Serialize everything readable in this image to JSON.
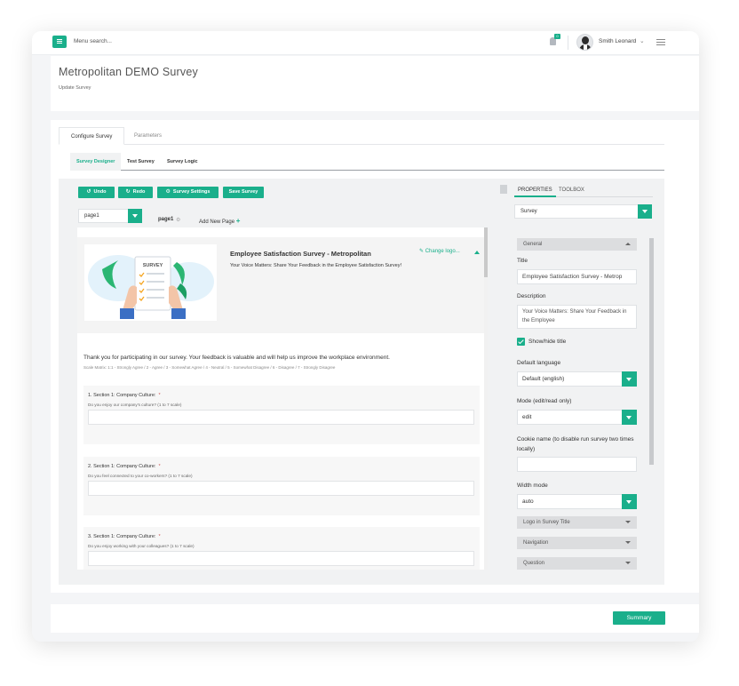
{
  "topbar": {
    "menu_placeholder": "Menu search...",
    "notification_count": "0",
    "user_name": "Smith Leonard",
    "user_caret": "⌄"
  },
  "header": {
    "title": "Metropolitan DEMO Survey",
    "subtitle": "Update Survey"
  },
  "outer_tabs": [
    "Configure Survey",
    "Parameters"
  ],
  "inner_tabs": [
    "Survey Designer",
    "Test Survey",
    "Survey Logic"
  ],
  "toolbar": {
    "undo": "Undo",
    "redo": "Redo",
    "settings": "Survey Settings",
    "save": "Save Survey",
    "page_select": "page1",
    "page_name": "page1",
    "add_page": "Add New Page"
  },
  "survey": {
    "title": "Employee Satisfaction Survey - Metropolitan",
    "description": "Your Voice Matters: Share Your Feedback in the Employee Satisfaction Survey!",
    "change_logo": "Change logo...",
    "logo_text": "SURVEY",
    "intro": "Thank you for participating in our survey. Your feedback is valuable and will help us improve the workplace environment.",
    "scale": "Scale Matrix: 1:1 - Strongly Agree / 2 - Agree / 3 - Somewhat Agree / 4 - Neutral / 5 - Somewhat Disagree / 6 - Disagree / 7 - Strongly Disagree",
    "questions": [
      {
        "title": "1.  Section 1: Company Culture:",
        "desc": "Do you enjoy our company's culture? (1 to 7 scale)"
      },
      {
        "title": "2.  Section 1: Company Culture:",
        "desc": "Do you feel connected to your co-workers? (1 to 7 scale)"
      },
      {
        "title": "3.  Section 1: Company Culture:",
        "desc": "Do you enjoy working with your colleagues? (1 to 7 scale)"
      }
    ],
    "required_mark": "*"
  },
  "properties": {
    "tabs": [
      "PROPERTIES",
      "TOOLBOX"
    ],
    "object_select": "Survey",
    "group_general": "General",
    "title_label": "Title",
    "title_value": "Employee Satisfaction Survey - Metrop",
    "description_label": "Description",
    "description_value": "Your Voice Matters: Share Your Feedback in the Employee",
    "show_title_label": "Show/hide title",
    "default_language_label": "Default language",
    "default_language_value": "Default (english)",
    "mode_label": "Mode (edit/read only)",
    "mode_value": "edit",
    "cookie_label": "Cookie name (to disable run survey two times locally)",
    "width_label": "Width mode",
    "width_value": "auto",
    "group_logo": "Logo in Survey Title",
    "group_navigation": "Navigation",
    "group_question": "Question"
  },
  "footer": {
    "summary": "Summary"
  },
  "colors": {
    "accent": "#1aaf8b",
    "background": "#f4f5f7"
  }
}
